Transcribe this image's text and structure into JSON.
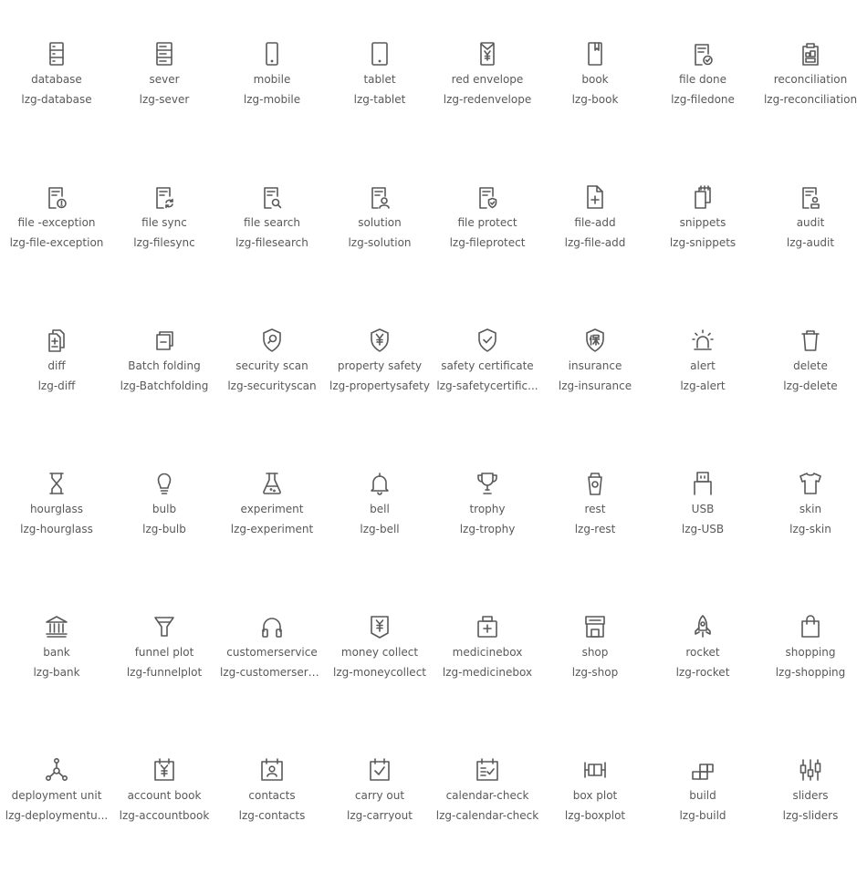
{
  "colors": {
    "icon": "#595959",
    "text": "#595959",
    "background": "#ffffff"
  },
  "icons": [
    {
      "name": "database",
      "class": "lzg-database",
      "icon": "database-icon"
    },
    {
      "name": "sever",
      "class": "lzg-sever",
      "icon": "server-icon"
    },
    {
      "name": "mobile",
      "class": "lzg-mobile",
      "icon": "mobile-icon"
    },
    {
      "name": "tablet",
      "class": "lzg-tablet",
      "icon": "tablet-icon"
    },
    {
      "name": "red envelope",
      "class": "lzg-redenvelope",
      "icon": "red-envelope-icon"
    },
    {
      "name": "book",
      "class": "lzg-book",
      "icon": "book-icon"
    },
    {
      "name": "file done",
      "class": "lzg-filedone",
      "icon": "file-done-icon"
    },
    {
      "name": "reconciliation",
      "class": "lzg-reconciliation",
      "icon": "reconciliation-icon"
    },
    {
      "name": "file -exception",
      "class": "lzg-file-exception",
      "icon": "file-exception-icon"
    },
    {
      "name": "file sync",
      "class": "lzg-filesync",
      "icon": "file-sync-icon"
    },
    {
      "name": "file search",
      "class": "lzg-filesearch",
      "icon": "file-search-icon"
    },
    {
      "name": "solution",
      "class": "lzg-solution",
      "icon": "solution-icon"
    },
    {
      "name": "file protect",
      "class": "lzg-fileprotect",
      "icon": "file-protect-icon"
    },
    {
      "name": "file-add",
      "class": "lzg-file-add",
      "icon": "file-add-icon"
    },
    {
      "name": "snippets",
      "class": "lzg-snippets",
      "icon": "snippets-icon"
    },
    {
      "name": "audit",
      "class": "lzg-audit",
      "icon": "audit-icon"
    },
    {
      "name": "diff",
      "class": "lzg-diff",
      "icon": "diff-icon"
    },
    {
      "name": "Batch folding",
      "class": "lzg-Batchfolding",
      "icon": "batch-folding-icon"
    },
    {
      "name": "security scan",
      "class": "lzg-securityscan",
      "icon": "security-scan-icon"
    },
    {
      "name": "property safety",
      "class": "lzg-propertysafety",
      "icon": "property-safety-icon"
    },
    {
      "name": "safety certificate",
      "class": "lzg-safetycertific...",
      "icon": "safety-certificate-icon"
    },
    {
      "name": "insurance",
      "class": "lzg-insurance",
      "icon": "insurance-icon"
    },
    {
      "name": "alert",
      "class": "lzg-alert",
      "icon": "alert-icon"
    },
    {
      "name": "delete",
      "class": "lzg-delete",
      "icon": "delete-icon"
    },
    {
      "name": "hourglass",
      "class": "lzg-hourglass",
      "icon": "hourglass-icon"
    },
    {
      "name": "bulb",
      "class": "lzg-bulb",
      "icon": "bulb-icon"
    },
    {
      "name": "experiment",
      "class": "lzg-experiment",
      "icon": "experiment-icon"
    },
    {
      "name": "bell",
      "class": "lzg-bell",
      "icon": "bell-icon"
    },
    {
      "name": "trophy",
      "class": "lzg-trophy",
      "icon": "trophy-icon"
    },
    {
      "name": "rest",
      "class": "lzg-rest",
      "icon": "rest-icon"
    },
    {
      "name": "USB",
      "class": "lzg-USB",
      "icon": "usb-icon"
    },
    {
      "name": "skin",
      "class": "lzg-skin",
      "icon": "skin-icon"
    },
    {
      "name": "bank",
      "class": "lzg-bank",
      "icon": "bank-icon"
    },
    {
      "name": "funnel plot",
      "class": "lzg-funnelplot",
      "icon": "funnel-plot-icon"
    },
    {
      "name": "customerservice",
      "class": "lzg-customerserv...",
      "icon": "customer-service-icon"
    },
    {
      "name": "money collect",
      "class": "lzg-moneycollect",
      "icon": "money-collect-icon"
    },
    {
      "name": "medicinebox",
      "class": "lzg-medicinebox",
      "icon": "medicine-box-icon"
    },
    {
      "name": "shop",
      "class": "lzg-shop",
      "icon": "shop-icon"
    },
    {
      "name": "rocket",
      "class": "lzg-rocket",
      "icon": "rocket-icon"
    },
    {
      "name": "shopping",
      "class": "lzg-shopping",
      "icon": "shopping-icon"
    },
    {
      "name": "deployment unit",
      "class": "lzg-deploymentu...",
      "icon": "deployment-unit-icon"
    },
    {
      "name": "account book",
      "class": "lzg-accountbook",
      "icon": "account-book-icon"
    },
    {
      "name": "contacts",
      "class": "lzg-contacts",
      "icon": "contacts-icon"
    },
    {
      "name": "carry out",
      "class": "lzg-carryout",
      "icon": "carry-out-icon"
    },
    {
      "name": "calendar-check",
      "class": "lzg-calendar-check",
      "icon": "calendar-check-icon"
    },
    {
      "name": "box plot",
      "class": "lzg-boxplot",
      "icon": "box-plot-icon"
    },
    {
      "name": "build",
      "class": "lzg-build",
      "icon": "build-icon"
    },
    {
      "name": "sliders",
      "class": "lzg-sliders",
      "icon": "sliders-icon"
    }
  ]
}
